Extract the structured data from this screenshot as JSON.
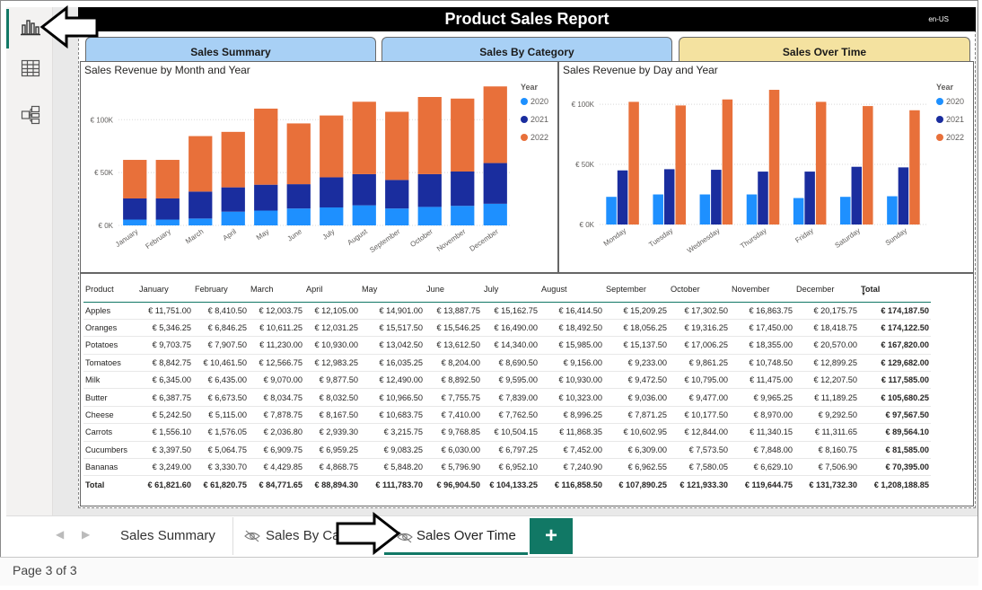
{
  "report": {
    "title": "Product Sales Report",
    "locale": "en-US"
  },
  "nav_tabs": [
    {
      "label": "Sales Summary"
    },
    {
      "label": "Sales By Category"
    },
    {
      "label": "Sales Over Time"
    }
  ],
  "colors": {
    "2020": "#1E90FF",
    "2021": "#1A2D9E",
    "2022": "#E8703A",
    "accent": "#117865",
    "tab_active": "#F4E2A0",
    "tab_inactive": "#A8D0F5"
  },
  "chart_data": [
    {
      "type": "bar",
      "stacked": true,
      "title": "Sales Revenue by Month and Year",
      "legend_title": "Year",
      "legend_position": "top-right",
      "categories": [
        "January",
        "February",
        "March",
        "April",
        "May",
        "June",
        "July",
        "August",
        "September",
        "October",
        "November",
        "December"
      ],
      "y_ticks": [
        "€ 0K",
        "€ 50K",
        "€ 100K"
      ],
      "ylim": [
        0,
        130000
      ],
      "series": [
        {
          "name": "2020",
          "values": [
            5500,
            5500,
            6500,
            13000,
            14000,
            16000,
            17000,
            19000,
            16000,
            17500,
            18500,
            20500
          ]
        },
        {
          "name": "2021",
          "values": [
            20000,
            20000,
            25500,
            23000,
            24500,
            23000,
            28500,
            29500,
            27000,
            31000,
            32500,
            38500
          ]
        },
        {
          "name": "2022",
          "values": [
            36500,
            36500,
            52500,
            52500,
            72000,
            57500,
            58500,
            68500,
            64500,
            73000,
            69000,
            72500
          ]
        }
      ]
    },
    {
      "type": "bar",
      "stacked": false,
      "title": "Sales Revenue by Day and Year",
      "legend_title": "Year",
      "legend_position": "top-right",
      "categories": [
        "Monday",
        "Tuesday",
        "Wednesday",
        "Thursday",
        "Friday",
        "Saturday",
        "Sunday"
      ],
      "y_ticks": [
        "€ 0K",
        "€ 50K",
        "€ 100K"
      ],
      "ylim": [
        0,
        115000
      ],
      "series": [
        {
          "name": "2020",
          "values": [
            23000,
            25000,
            25000,
            25000,
            22000,
            23000,
            23500
          ]
        },
        {
          "name": "2021",
          "values": [
            45000,
            46000,
            45500,
            44000,
            44000,
            48000,
            47500
          ]
        },
        {
          "name": "2022",
          "values": [
            102000,
            99000,
            104000,
            112000,
            102000,
            98500,
            95000
          ]
        }
      ]
    }
  ],
  "table": {
    "headers": [
      "Product",
      "January",
      "February",
      "March",
      "April",
      "May",
      "June",
      "July",
      "August",
      "September",
      "October",
      "November",
      "December",
      "Total"
    ],
    "rows": [
      [
        "Apples",
        "€ 11,751.00",
        "€ 8,410.50",
        "€ 12,003.75",
        "€ 12,105.00",
        "€ 14,901.00",
        "€ 13,887.75",
        "€ 15,162.75",
        "€ 16,414.50",
        "€ 15,209.25",
        "€ 17,302.50",
        "€ 16,863.75",
        "€ 20,175.75",
        "€ 174,187.50"
      ],
      [
        "Oranges",
        "€ 5,346.25",
        "€ 6,846.25",
        "€ 10,611.25",
        "€ 12,031.25",
        "€ 15,517.50",
        "€ 15,546.25",
        "€ 16,490.00",
        "€ 18,492.50",
        "€ 18,056.25",
        "€ 19,316.25",
        "€ 17,450.00",
        "€ 18,418.75",
        "€ 174,122.50"
      ],
      [
        "Potatoes",
        "€ 9,703.75",
        "€ 7,907.50",
        "€ 11,230.00",
        "€ 10,930.00",
        "€ 13,042.50",
        "€ 13,612.50",
        "€ 14,340.00",
        "€ 15,985.00",
        "€ 15,137.50",
        "€ 17,006.25",
        "€ 18,355.00",
        "€ 20,570.00",
        "€ 167,820.00"
      ],
      [
        "Tomatoes",
        "€ 8,842.75",
        "€ 10,461.50",
        "€ 12,566.75",
        "€ 12,983.25",
        "€ 16,035.25",
        "€ 8,204.00",
        "€ 8,690.50",
        "€ 9,156.00",
        "€ 9,233.00",
        "€ 9,861.25",
        "€ 10,748.50",
        "€ 12,899.25",
        "€ 129,682.00"
      ],
      [
        "Milk",
        "€ 6,345.00",
        "€ 6,435.00",
        "€ 9,070.00",
        "€ 9,877.50",
        "€ 12,490.00",
        "€ 8,892.50",
        "€ 9,595.00",
        "€ 10,930.00",
        "€ 9,472.50",
        "€ 10,795.00",
        "€ 11,475.00",
        "€ 12,207.50",
        "€ 117,585.00"
      ],
      [
        "Butter",
        "€ 6,387.75",
        "€ 6,673.50",
        "€ 8,034.75",
        "€ 8,032.50",
        "€ 10,966.50",
        "€ 7,755.75",
        "€ 7,839.00",
        "€ 10,323.00",
        "€ 9,036.00",
        "€ 9,477.00",
        "€ 9,965.25",
        "€ 11,189.25",
        "€ 105,680.25"
      ],
      [
        "Cheese",
        "€ 5,242.50",
        "€ 5,115.00",
        "€ 7,878.75",
        "€ 8,167.50",
        "€ 10,683.75",
        "€ 7,410.00",
        "€ 7,762.50",
        "€ 8,996.25",
        "€ 7,871.25",
        "€ 10,177.50",
        "€ 8,970.00",
        "€ 9,292.50",
        "€ 97,567.50"
      ],
      [
        "Carrots",
        "€ 1,556.10",
        "€ 1,576.05",
        "€ 2,036.80",
        "€ 2,939.30",
        "€ 3,215.75",
        "€ 9,768.85",
        "€ 10,504.15",
        "€ 11,868.35",
        "€ 10,602.95",
        "€ 12,844.00",
        "€ 11,340.15",
        "€ 11,311.65",
        "€ 89,564.10"
      ],
      [
        "Cucumbers",
        "€ 3,397.50",
        "€ 5,064.75",
        "€ 6,909.75",
        "€ 6,959.25",
        "€ 9,083.25",
        "€ 6,030.00",
        "€ 6,797.25",
        "€ 7,452.00",
        "€ 6,309.00",
        "€ 7,573.50",
        "€ 7,848.00",
        "€ 8,160.75",
        "€ 81,585.00"
      ],
      [
        "Bananas",
        "€ 3,249.00",
        "€ 3,330.70",
        "€ 4,429.85",
        "€ 4,868.75",
        "€ 5,848.20",
        "€ 5,796.90",
        "€ 6,952.10",
        "€ 7,240.90",
        "€ 6,962.55",
        "€ 7,580.05",
        "€ 6,629.10",
        "€ 7,506.90",
        "€ 70,395.00"
      ]
    ],
    "total_row": [
      "Total",
      "€ 61,821.60",
      "€ 61,820.75",
      "€ 84,771.65",
      "€ 88,894.30",
      "€ 111,783.70",
      "€ 96,904.50",
      "€ 104,133.25",
      "€ 116,858.50",
      "€ 107,890.25",
      "€ 121,933.30",
      "€ 119,644.75",
      "€ 131,732.30",
      "€ 1,208,188.85"
    ]
  },
  "page_tabs": [
    {
      "label": "Sales Summary"
    },
    {
      "label": "Sales By Ca"
    },
    {
      "label": "Sales Over Time"
    }
  ],
  "add_page_label": "+",
  "status": "Page 3 of 3"
}
